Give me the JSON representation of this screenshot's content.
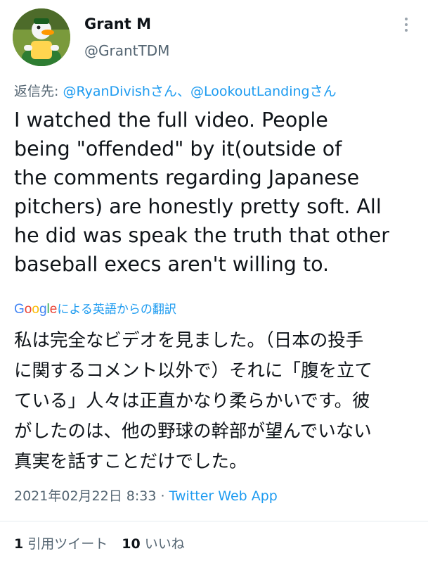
{
  "author": {
    "display_name": "Grant M",
    "handle": "@GrantTDM",
    "avatar_icon": "duck-mascot-avatar"
  },
  "reply": {
    "prefix": "返信先: ",
    "mention1": "@RyanDivish",
    "suffix1": "さん、",
    "mention2": "@LookoutLanding",
    "suffix2": "さん"
  },
  "tweet": {
    "text": "I watched the full video.  People\nbeing \"offended\" by it(outside of\nthe comments regarding Japanese\npitchers) are honestly pretty soft.  All\nhe did was speak the truth that other\nbaseball execs aren't willing to."
  },
  "translation": {
    "label": "による英語からの翻訳",
    "google_letters": [
      "G",
      "o",
      "o",
      "g",
      "l",
      "e"
    ],
    "google_colors": [
      "#4285F4",
      "#EA4335",
      "#FBBC05",
      "#4285F4",
      "#34A853",
      "#EA4335"
    ],
    "text": "私は完全なビデオを見ました。（日本の投手\nに関するコメント以外で）それに「腹を立て\nている」人々は正直かなり柔らかいです。彼\nがしたのは、他の野球の幹部が望んでいない\n真実を話すことだけでした。"
  },
  "meta": {
    "timestamp": "2021年02月22日 8:33",
    "separator": " · ",
    "source": "Twitter Web App"
  },
  "stats": {
    "quote_count": "1",
    "quote_label": "引用ツイート",
    "like_count": "10",
    "like_label": "いいね"
  },
  "colors": {
    "link": "#1d9bf0",
    "secondary_text": "#536471",
    "primary_text": "#0f1419"
  }
}
